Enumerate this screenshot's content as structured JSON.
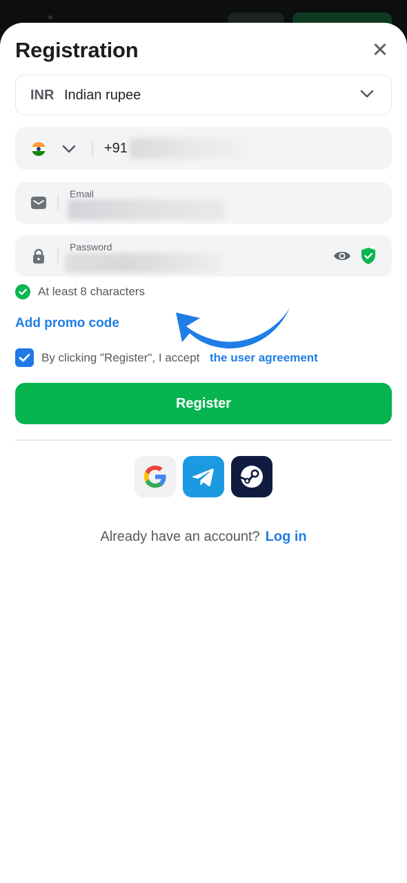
{
  "header": {
    "title": "Registration"
  },
  "currency": {
    "code": "INR",
    "name": "Indian rupee"
  },
  "phone": {
    "country_code": "+91"
  },
  "email": {
    "label": "Email"
  },
  "password": {
    "label": "Password"
  },
  "hint": {
    "text": "At least 8 characters"
  },
  "promo": {
    "label": "Add promo code"
  },
  "agreement": {
    "text": "By clicking \"Register\", I accept",
    "link": "the user agreement",
    "checked": true
  },
  "register_button": {
    "label": "Register"
  },
  "social": [
    "google",
    "telegram",
    "steam"
  ],
  "footer": {
    "question": "Already have an account?",
    "login_label": "Log in"
  },
  "colors": {
    "primary_green": "#07b44f",
    "link_blue": "#1f7de6",
    "arrow_blue": "#1f7de6"
  }
}
